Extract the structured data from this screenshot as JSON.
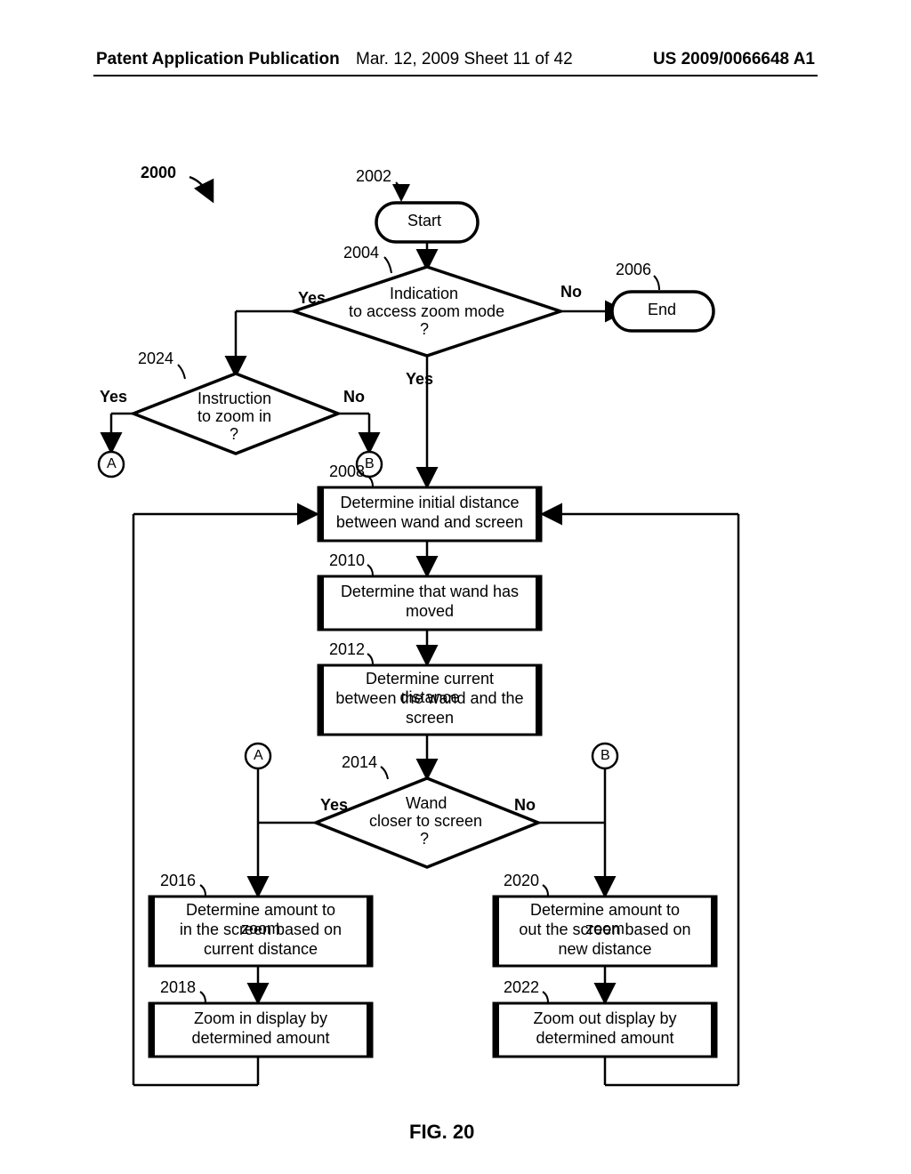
{
  "header": {
    "left": "Patent Application Publication",
    "mid": "Mar. 12, 2009  Sheet 11 of 42",
    "right": "US 2009/0066648 A1"
  },
  "labels": {
    "n2000": "2000",
    "n2002": "2002",
    "n2004": "2004",
    "n2006": "2006",
    "n2008": "2008",
    "n2010": "2010",
    "n2012": "2012",
    "n2014": "2014",
    "n2016": "2016",
    "n2018": "2018",
    "n2020": "2020",
    "n2022": "2022",
    "n2024": "2024",
    "start": "Start",
    "end": "End",
    "yes": "Yes",
    "no": "No",
    "A": "A",
    "B": "B",
    "d1l1": "Indication",
    "d1l2": "to access zoom mode",
    "d1l3": "?",
    "d2l1": "Instruction",
    "d2l2": "to zoom in",
    "d2l3": "?",
    "p1l1": "Determine initial distance",
    "p1l2": "between wand and screen",
    "p2l1": "Determine that wand has",
    "p2l2": "moved",
    "p3l1": "Determine current distance",
    "p3l2": "between the wand and the",
    "p3l3": "screen",
    "d3l1": "Wand",
    "d3l2": "closer to screen",
    "d3l3": "?",
    "p4l1": "Determine amount to zoom",
    "p4l2": "in the screen based on",
    "p4l3": "current distance",
    "p5l1": "Zoom in display by",
    "p5l2": "determined amount",
    "p6l1": "Determine amount to zoom",
    "p6l2": "out the screen based on",
    "p6l3": "new distance",
    "p7l1": "Zoom out display by",
    "p7l2": "determined amount",
    "fig": "FIG. 20"
  }
}
